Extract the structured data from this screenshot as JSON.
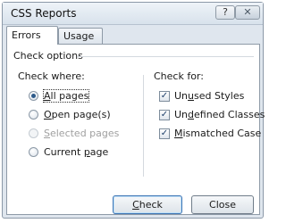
{
  "window": {
    "title": "CSS Reports",
    "help_label": "?",
    "close_label": "✕"
  },
  "tabs": [
    {
      "label": "Errors"
    },
    {
      "label": "Usage"
    }
  ],
  "group": {
    "label": "Check options"
  },
  "check_where": {
    "label": "Check where:",
    "options": [
      {
        "pre": "",
        "key": "A",
        "post": "ll pages",
        "selected": true,
        "disabled": false
      },
      {
        "pre": "",
        "key": "O",
        "post": "pen page(s)",
        "selected": false,
        "disabled": false
      },
      {
        "pre": "",
        "key": "S",
        "post": "elected pages",
        "selected": false,
        "disabled": true
      },
      {
        "pre": "Current ",
        "key": "p",
        "post": "age",
        "selected": false,
        "disabled": false
      }
    ]
  },
  "check_for": {
    "label": "Check for:",
    "options": [
      {
        "pre": "Un",
        "key": "u",
        "post": "sed Styles",
        "checked": true
      },
      {
        "pre": "Un",
        "key": "d",
        "post": "efined Classes",
        "checked": true
      },
      {
        "pre": "",
        "key": "M",
        "post": "ismatched Case",
        "checked": true
      }
    ]
  },
  "buttons": {
    "check": {
      "pre": "",
      "key": "C",
      "post": "heck"
    },
    "close": {
      "label": "Close"
    }
  }
}
